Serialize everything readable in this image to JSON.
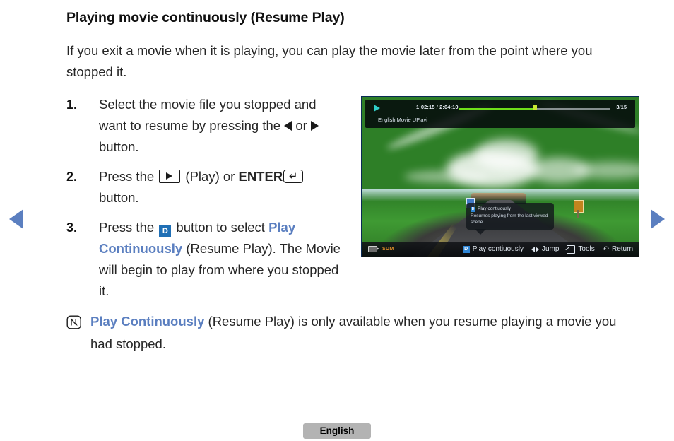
{
  "nav": {
    "prev_icon": "triangle-left-icon",
    "next_icon": "triangle-right-icon",
    "arrow_color": "#5B7FC0"
  },
  "page": {
    "title": "Playing movie continuously (Resume Play)",
    "intro": "If you exit a movie when it is playing, you can play the movie later from the point where you stopped it.",
    "footer_badge": "English"
  },
  "steps": [
    {
      "number": "1.",
      "text_a": "Select the movie file you stopped and want to resume by pressing the ",
      "text_b": " or ",
      "text_c": " button."
    },
    {
      "number": "2.",
      "text_a": "Press the ",
      "text_b": " (Play) or ",
      "text_c": "ENTER",
      "text_d": " button."
    },
    {
      "number": "3.",
      "text_a": "Press the ",
      "badge": "D",
      "text_b": " button to select ",
      "highlight": "Play Continuously",
      "text_c": " (Resume Play). The Movie will begin to play from where you stopped it."
    }
  ],
  "note": {
    "icon": "note-pencil-icon",
    "highlight": "Play Continuously",
    "text": " (Resume Play) is only available when you resume playing a movie you had stopped."
  },
  "colors": {
    "link_blue": "#5B7FC0",
    "badge_blue": "#1F6FB5",
    "osd_orange": "#E8932A",
    "progress_green": "#6FE01A"
  },
  "tv": {
    "osd": {
      "play_icon": "play-triangle-icon",
      "time": "1:02:15 / 2:04:10",
      "progress_percent": 50,
      "count": "3/15",
      "filename": "English Movie UP.avi"
    },
    "tooltip": {
      "badge": "D",
      "title": "Play contiuously",
      "body": "Resumes playing from the last viewed scene."
    },
    "bottom_bar": {
      "source_icon": "usb-device-icon",
      "source_label": "SUM",
      "actions": [
        {
          "badge": "D",
          "icon": "d-button-icon",
          "label": "Play contiuously"
        },
        {
          "badge": "",
          "icon": "left-right-arrows-icon",
          "label": "Jump"
        },
        {
          "badge": "",
          "icon": "tools-icon",
          "label": "Tools"
        },
        {
          "badge": "",
          "icon": "return-arrow-icon",
          "label": "Return"
        }
      ]
    }
  }
}
